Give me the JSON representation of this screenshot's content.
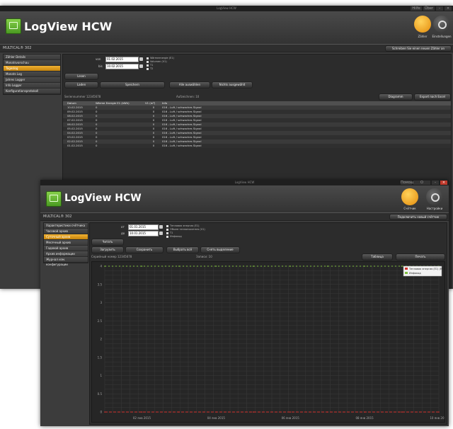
{
  "back_window": {
    "title": "LogView HCW",
    "window_title": "LogView HCW",
    "window_buttons": [
      "Hilfe",
      "Über",
      "–",
      "×"
    ],
    "header_buttons": [
      {
        "label": "Zähler",
        "icon": "meter-icon"
      },
      {
        "label": "Einstellungen",
        "icon": "gear-icon"
      }
    ],
    "crumb": "MULTICAL® 302",
    "top_right_button": "Schreiben Sie einen neuen Zähler an",
    "sidebar": [
      "Zähler Details",
      "Monatsvorschau",
      "Tageslog",
      "Monats Log",
      "Jahres Logger",
      "Info Logger",
      "Konfigurationsprotokoll"
    ],
    "active_index": 2,
    "from_label": "von",
    "to_label": "bis",
    "from_date": "01.02.2015",
    "to_date": "10.02.2015",
    "checkboxes": [
      "Wärmeenergie (E1)",
      "Volumen (V1)",
      "T1",
      "T2"
    ],
    "buttons": {
      "lesen": "Lesen",
      "laden": "Laden",
      "speichern": "Speichern",
      "alle": "Alle auswählen",
      "nichts": "Nichts ausgewählt",
      "diagramm": "Diagramm",
      "export": "Export nach Excel"
    },
    "meta_left": "Seriennummer 12345678",
    "meta_mid": "Aufzeichnen: 10",
    "table_headers": [
      "Datum",
      "Wärme Energie E1 (kWh)",
      "V1 (m³)",
      "Info"
    ],
    "rows": [
      [
        "10.02.2015",
        "0",
        "0",
        "016 - Luft / schwaches Signal"
      ],
      [
        "09.02.2015",
        "0",
        "0",
        "016 - Luft / schwaches Signal"
      ],
      [
        "08.02.2015",
        "0",
        "0",
        "016 - Luft / schwaches Signal"
      ],
      [
        "07.02.2015",
        "0",
        "0",
        "016 - Luft / schwaches Signal"
      ],
      [
        "06.02.2015",
        "0",
        "0",
        "016 - Luft / schwaches Signal"
      ],
      [
        "05.02.2015",
        "0",
        "0",
        "016 - Luft / schwaches Signal"
      ],
      [
        "04.02.2015",
        "0",
        "0",
        "016 - Luft / schwaches Signal"
      ],
      [
        "03.02.2015",
        "0",
        "0",
        "016 - Luft / schwaches Signal"
      ],
      [
        "02.02.2015",
        "0",
        "0",
        "016 - Luft / schwaches Signal"
      ],
      [
        "01.02.2015",
        "0",
        "0",
        "016 - Luft / schwaches Signal"
      ]
    ]
  },
  "front_window": {
    "title": "LogView HCW",
    "window_title": "LogView HCW",
    "window_buttons": [
      "Помощь",
      "О программе",
      "–",
      "×"
    ],
    "header_buttons": [
      {
        "label": "Счётчик",
        "icon": "meter-icon"
      },
      {
        "label": "Настройки",
        "icon": "gear-icon"
      }
    ],
    "crumb": "MULTICAL® 302",
    "top_right_button": "Подключить новый счётчик",
    "sidebar": [
      "Характеристики счётчика",
      "Часовой архив",
      "Суточный архив",
      "Месячный архив",
      "Годовой архив",
      "Архив информации",
      "Журнал изм. конфигурации"
    ],
    "active_index": 2,
    "from_label": "от",
    "to_label": "до",
    "from_date": "01.01.2015",
    "to_date": "10.01.2015",
    "checkboxes": [
      "Тепловая энергия (E1)",
      "Объем теплоносителя (V1)",
      "T1",
      "Инфокод"
    ],
    "buttons": {
      "read": "Читать",
      "load": "Загрузить",
      "save": "Сохранить",
      "select_all": "Выбрать всё",
      "deselect": "Снять выделение",
      "table": "Таблица",
      "print": "Печать"
    },
    "meta_left": "Серийный номер 12345678",
    "meta_mid": "Записи: 10",
    "legend": [
      "Тепловая энергия (E1) (MWh)",
      "Инфокод"
    ],
    "x_ticks": [
      "02 янв 2015",
      "04 янв 2015",
      "06 янв 2015",
      "08 янв 2015",
      "10 янв 2015"
    ],
    "y_ticks": [
      "0",
      "0.5",
      "1",
      "1.5",
      "2",
      "2.5",
      "3",
      "3.5",
      "4"
    ]
  },
  "chart_data": {
    "type": "line",
    "x": [
      "01 янв 2015",
      "02 янв 2015",
      "03 янв 2015",
      "04 янв 2015",
      "05 янв 2015",
      "06 янв 2015",
      "07 янв 2015",
      "08 янв 2015",
      "09 янв 2015",
      "10 янв 2015"
    ],
    "series": [
      {
        "name": "Тепловая энергия (E1) (MWh)",
        "values": [
          0,
          0,
          0,
          0,
          0,
          0,
          0,
          0,
          0,
          0
        ],
        "color": "#d0312d"
      },
      {
        "name": "Инфокод",
        "values": [
          4,
          4,
          4,
          4,
          4,
          4,
          4,
          4,
          4,
          4
        ],
        "color": "#7fbf3f"
      }
    ],
    "ylim": [
      0,
      4
    ],
    "grid": true,
    "legend_position": "top-right"
  },
  "colors": {
    "accent": "#e8a020",
    "background": "#3c3c3c",
    "energy": "#d0312d",
    "infocode": "#7fbf3f"
  }
}
